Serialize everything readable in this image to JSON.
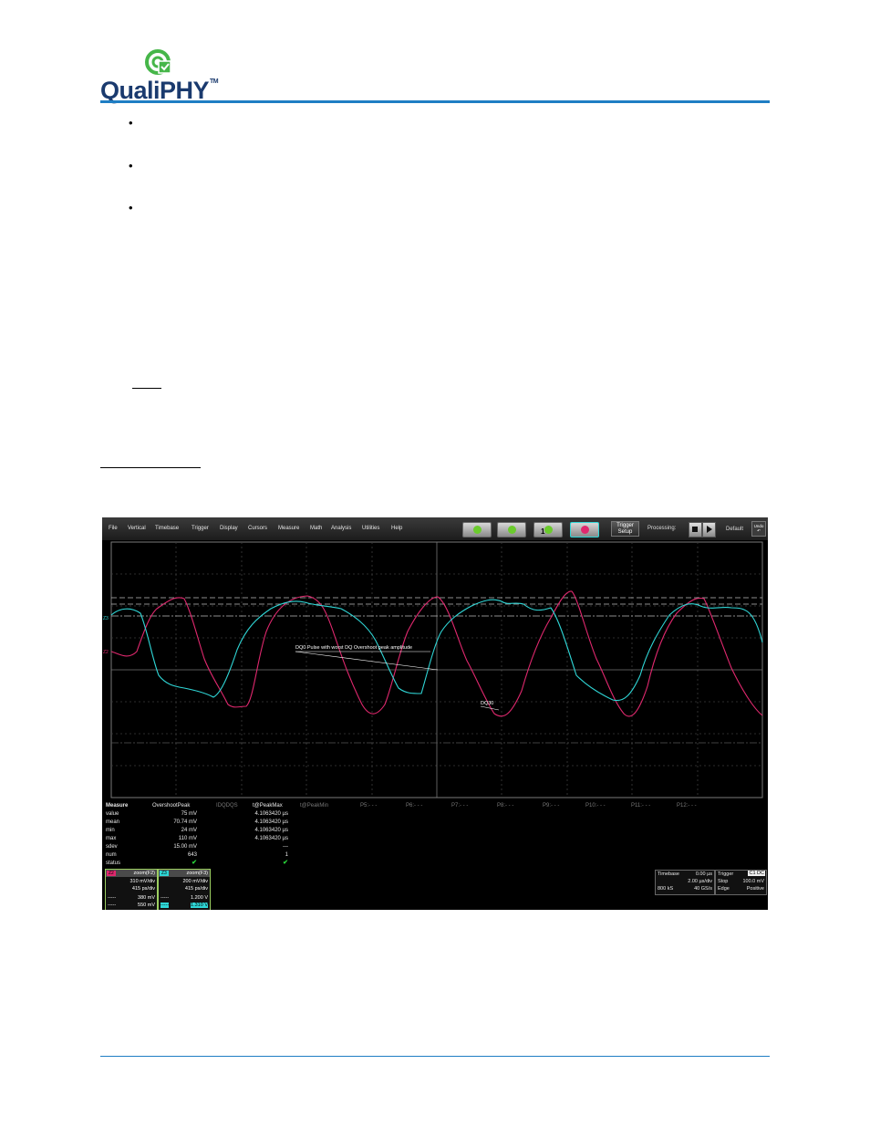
{
  "header": {
    "logo_text": "QualiPHY",
    "logo_tm": "TM",
    "colors": {
      "rule": "#1f7ec4",
      "logo_green": "#46b649",
      "logo_navy": "#1a3a6e"
    }
  },
  "bullets": [
    "•",
    "•",
    "•"
  ],
  "scope": {
    "menu": [
      "File",
      "Vertical",
      "Timebase",
      "Trigger",
      "Display",
      "Cursors",
      "Measure",
      "Math",
      "Analysis",
      "Utilities",
      "Help"
    ],
    "trigger_setup": [
      "Trigger",
      "Setup"
    ],
    "processing_label": "Processing:",
    "default_label": "Default",
    "undo_label": [
      "Undo",
      "↶"
    ],
    "toolbar_badge": "1",
    "annotations": {
      "pulse_label": "DQ0 Pulse with worst DQ Overshoot peak amplitude",
      "signal_label": "DQ30"
    },
    "trace_colors": {
      "cyan": "#2fd6d6",
      "magenta": "#e0286e"
    },
    "measure": {
      "row_labels": [
        "Measure",
        "value",
        "mean",
        "min",
        "max",
        "sdev",
        "num",
        "status"
      ],
      "headers": [
        "OvershootPeak",
        "IDQDQS",
        "t@PeakMax",
        "t@PeakMin",
        "P5:- - -",
        "P6:- - -",
        "P7:- - -",
        "P8:- - -",
        "P9:- - -",
        "P10:- - -",
        "P11:- - -",
        "P12:- - -"
      ],
      "col1": [
        "75 mV",
        "70.74 mV",
        "24 mV",
        "110 mV",
        "15.00 mV",
        "643",
        "✔"
      ],
      "col3": [
        "4.1063420 µs",
        "4.1063420 µs",
        "4.1063420 µs",
        "4.1063420 µs",
        "---",
        "1",
        "✔"
      ]
    },
    "z2": {
      "tag": "Z2",
      "title": "zoom(F2)",
      "rows": [
        [
          "",
          "310 mV/div"
        ],
        [
          "",
          "415 ps/div"
        ],
        [
          "-----",
          "380 mV"
        ],
        [
          "-----",
          "550 mV"
        ]
      ],
      "color": "#e0286e"
    },
    "z3": {
      "tag": "Z3",
      "title": "zoom(F3)",
      "rows": [
        [
          "",
          "200 mV/div"
        ],
        [
          "",
          "415 ps/div"
        ],
        [
          "-----",
          "1.200 V"
        ],
        [
          "-----",
          "1.310 V"
        ]
      ],
      "color": "#2fd6d6"
    },
    "timebase": {
      "label": "Timebase",
      "delay": "0.00 µs",
      "div": "2.00 µs/div",
      "pts": "800 kS",
      "rate": "40 GS/s"
    },
    "trigger": {
      "label": "Trigger",
      "badge": "C1 DC",
      "mode": "Stop",
      "level": "100.0 mV",
      "type": "Edge",
      "slope": "Positive"
    }
  }
}
